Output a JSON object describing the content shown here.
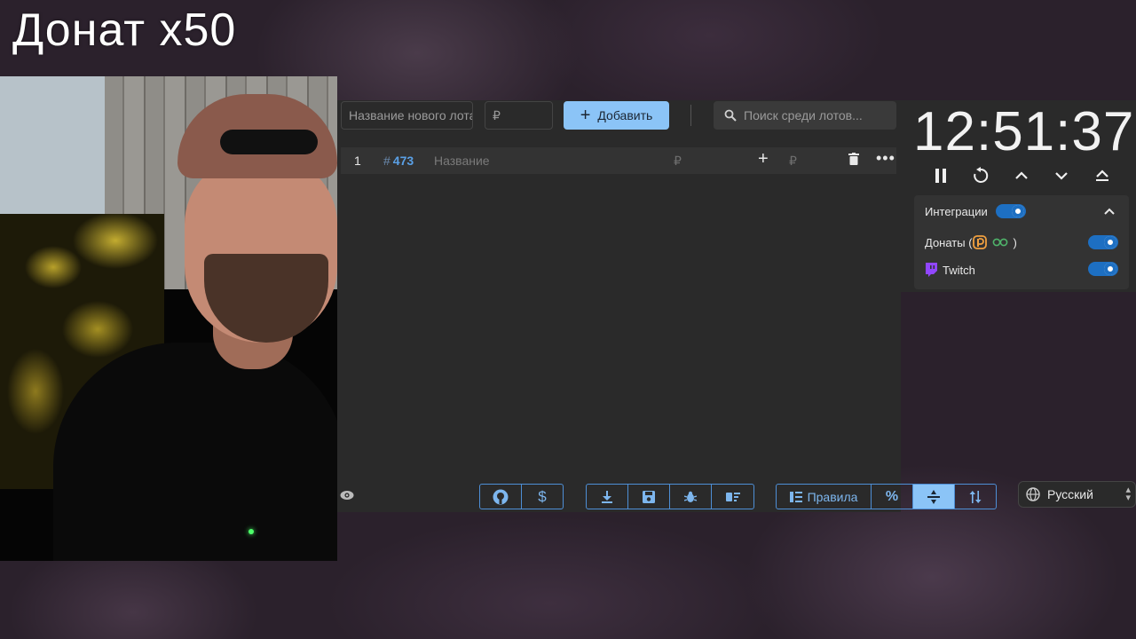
{
  "overlay": {
    "title": "Донат x50"
  },
  "toolbar": {
    "name_placeholder": "Название нового лота",
    "price_placeholder": "₽",
    "add_label": "Добавить",
    "search_placeholder": "Поиск среди лотов..."
  },
  "lots": [
    {
      "index": "1",
      "id": "473",
      "name_placeholder": "Название",
      "amount_placeholder": "₽",
      "add_amount_placeholder": "₽"
    }
  ],
  "footer": {
    "rules_label": "Правила",
    "percent_label": "%",
    "language": "Русский"
  },
  "timer": {
    "time": "12:51:37"
  },
  "integrations": {
    "title": "Интеграции",
    "donations_label": "Донаты (",
    "donations_close": ")",
    "twitch_label": "Twitch",
    "enabled": true,
    "donations_enabled": true,
    "twitch_enabled": true
  },
  "icons": [
    "plus-icon",
    "search-icon",
    "trash-icon",
    "more-icon",
    "eye-icon",
    "github-icon",
    "dollar-icon",
    "download-icon",
    "save-icon",
    "bug-icon",
    "clear-list-icon",
    "rules-icon",
    "compress-icon",
    "sort-icon",
    "globe-icon",
    "pause-icon",
    "restart-icon",
    "chevron-up-icon",
    "chevron-down-icon",
    "collapse-icon",
    "donationalerts-icon",
    "twitch-icon"
  ],
  "colors": {
    "accent": "#8bc4f7",
    "toggle": "#1d6fc2",
    "twitch": "#9146ff",
    "id": "#5aa0e6"
  }
}
